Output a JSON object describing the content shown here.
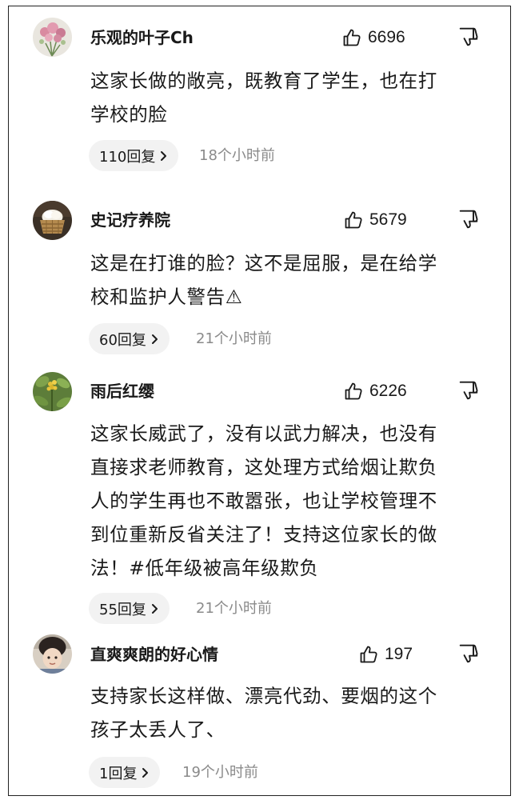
{
  "comments": [
    {
      "username": "乐观的叶子Ch",
      "avatar": "flower-avatar",
      "likes": "6696",
      "content_lines": [
        "这家长做的敞亮，既教育了学生，也在打",
        "学校的脸"
      ],
      "replies": "110回复",
      "time": "18个小时前"
    },
    {
      "username": "史记疗养院",
      "avatar": "bread-basket-avatar",
      "likes": "5679",
      "content_lines": [
        "这是在打谁的脸？这不是屈服，是在给学",
        "校和监护人警告⚠"
      ],
      "replies": "60回复",
      "time": "21个小时前"
    },
    {
      "username": "雨后红缨",
      "avatar": "plant-avatar",
      "likes": "6226",
      "content_lines": [
        "这家长威武了，没有以武力解决，也没有",
        "直接求老师教育，这处理方式给烟让欺负",
        "人的学生再也不敢嚣张，也让学校管理不",
        "到位重新反省关注了！支持这位家长的做",
        "法！#低年级被高年级欺负"
      ],
      "replies": "55回复",
      "time": "21个小时前"
    },
    {
      "username": "直爽爽朗的好心情",
      "avatar": "child-photo-avatar",
      "likes": "197",
      "content_lines": [
        "支持家长这样做、漂亮代劲、要烟的这个",
        "孩子太丢人了、"
      ],
      "replies": "1回复",
      "time": "19个小时前"
    }
  ],
  "icons": {
    "like": "thumbs-up-icon",
    "dislike": "thumbs-down-icon",
    "reply_chevron": "chevron-right-icon"
  },
  "colors": {
    "text": "#1a1a1a",
    "muted": "#8a8a8a",
    "pill_bg": "#f2f2f2"
  }
}
